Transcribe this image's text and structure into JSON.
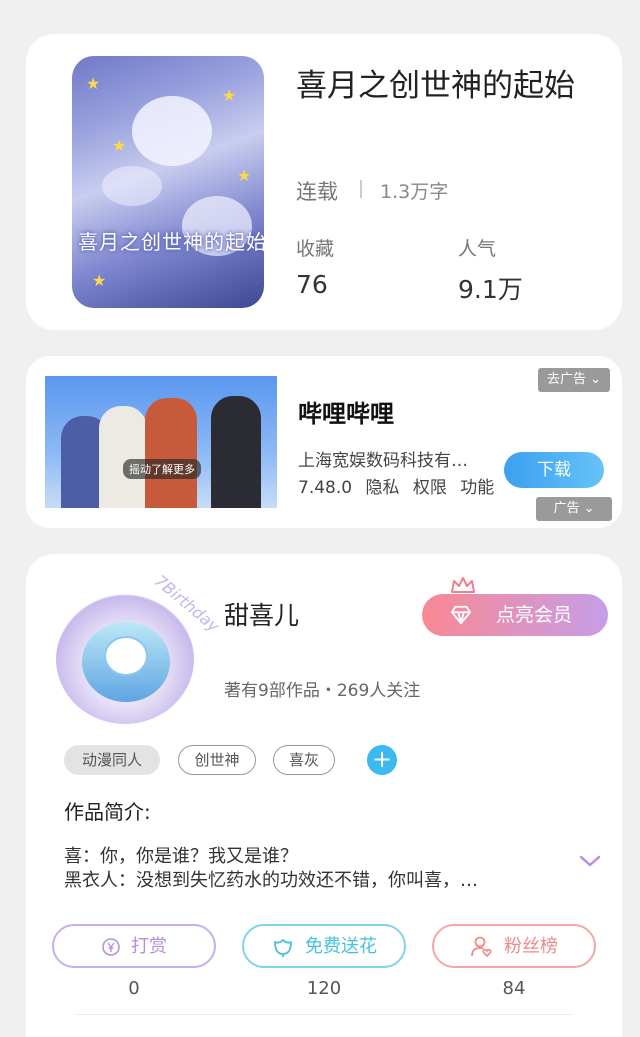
{
  "book": {
    "title": "喜月之创世神的起始",
    "status": "连载",
    "word_count": "1.3万字",
    "favorites_label": "收藏",
    "favorites_value": "76",
    "popularity_label": "人气",
    "popularity_value": "9.1万",
    "cover_text": "喜月之创世神的起始"
  },
  "ad": {
    "app_name": "哔哩哔哩",
    "company": "上海宽娱数码科技有…",
    "version": "7.48.0",
    "privacy": "隐私",
    "permissions": "权限",
    "features": "功能",
    "download_label": "下载",
    "close_label": "去广告 ⌄",
    "ad_tag": "广告 ⌄",
    "thumb_caption": "摇动了解更多"
  },
  "author": {
    "name": "甜喜儿",
    "info": "著有9部作品・269人关注",
    "vip_label": "点亮会员",
    "avatar_text": "7Birthday",
    "tags": [
      "动漫同人",
      "创世神",
      "喜灰"
    ],
    "add_tag": "+",
    "intro_label": "作品简介:",
    "intro_lines": [
      "喜：你，你是谁？我又是谁？",
      "黑衣人：没想到失忆药水的功效还不错，你叫喜，…"
    ]
  },
  "actions": [
    {
      "label": "打赏",
      "count": "0",
      "color": "#b68fe0"
    },
    {
      "label": "免费送花",
      "count": "120",
      "color": "#46c1e0"
    },
    {
      "label": "粉丝榜",
      "count": "84",
      "color": "#f08a8a"
    }
  ],
  "colors": {
    "accent_blue": "#3cb9ee",
    "vip_gradient_start": "#f98893",
    "vip_gradient_end": "#c69ee8"
  }
}
